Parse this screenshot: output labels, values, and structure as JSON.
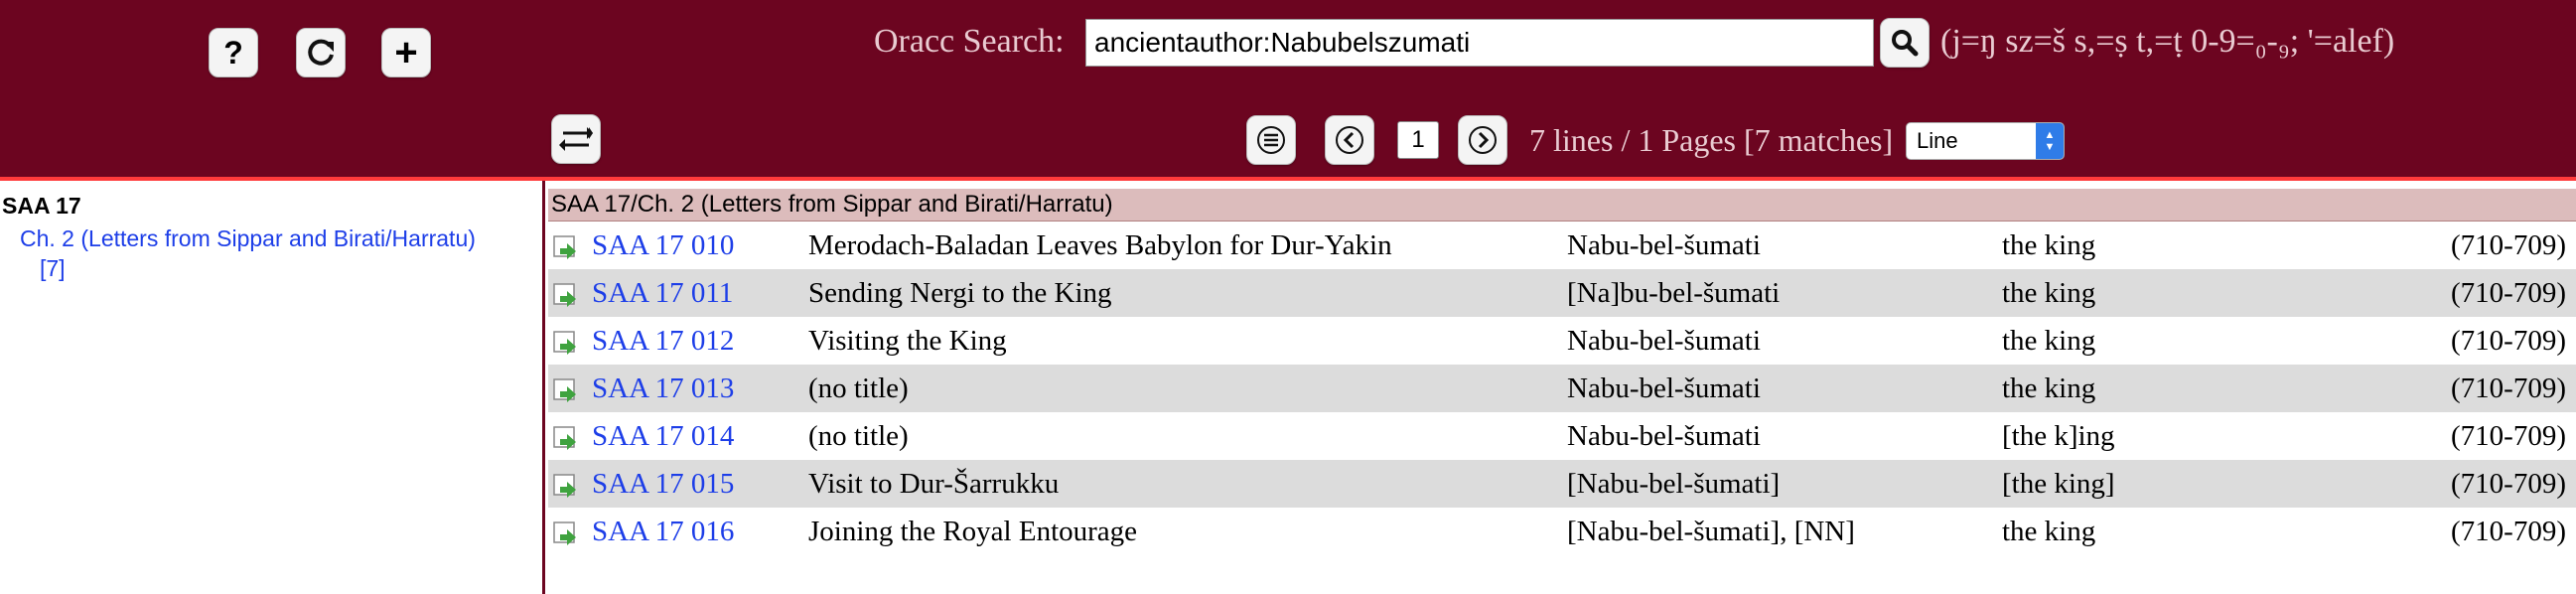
{
  "toolbar": {
    "buttons": [
      {
        "name": "help",
        "icon": "question-icon",
        "label": "?"
      },
      {
        "name": "reset",
        "icon": "refresh-icon"
      },
      {
        "name": "add",
        "icon": "plus-icon",
        "label": "+"
      }
    ]
  },
  "search": {
    "label": "Oracc Search:",
    "value": "ancientauthor:Nabubelszumati",
    "button_icon": "search-icon",
    "hint": "(j=ŋ sz=š s,=ṣ t,=ṭ 0-9=₀-₉; '=alef)"
  },
  "pager": {
    "swap_icon": "swap-arrows-icon",
    "menu_icon": "menu-lines-icon",
    "prev_icon": "chevron-left-icon",
    "next_icon": "chevron-right-icon",
    "page": "1",
    "summary": "7 lines / 1 Pages [7 matches]",
    "view_mode": "Line"
  },
  "sidebar": {
    "title": "SAA 17",
    "chapter": "Ch. 2 (Letters from Sippar and Birati/Harratu)",
    "count": "[7]"
  },
  "results": {
    "header": "SAA 17/Ch. 2 (Letters from Sippar and Birati/Harratu)",
    "rows": [
      {
        "id": "SAA 17 010",
        "title": "Merodach-Baladan Leaves Babylon for Dur-Yakin",
        "author": "Nabu-bel-šumati",
        "recipient": "the king",
        "date": "(710-709)"
      },
      {
        "id": "SAA 17 011",
        "title": "Sending Nergi to the King",
        "author": "[Na]bu-bel-šumati",
        "recipient": "the king",
        "date": "(710-709)"
      },
      {
        "id": "SAA 17 012",
        "title": "Visiting the King",
        "author": "Nabu-bel-šumati",
        "recipient": "the king",
        "date": "(710-709)"
      },
      {
        "id": "SAA 17 013",
        "title": "(no title)",
        "author": "Nabu-bel-šumati",
        "recipient": "the king",
        "date": "(710-709)"
      },
      {
        "id": "SAA 17 014",
        "title": "(no title)",
        "author": "Nabu-bel-šumati",
        "recipient": "[the k]ing",
        "date": "(710-709)"
      },
      {
        "id": "SAA 17 015",
        "title": "Visit to Dur-Šarrukku",
        "author": "[Nabu-bel-šumati]",
        "recipient": "[the king]",
        "date": "(710-709)"
      },
      {
        "id": "SAA 17 016",
        "title": "Joining the Royal Entourage",
        "author": "[Nabu-bel-šumati], [NN]",
        "recipient": "the king",
        "date": "(710-709)"
      }
    ]
  },
  "colors": {
    "header_bg": "#6c0520",
    "accent_line": "#ff3b3b",
    "link": "#1d3ee8",
    "row_alt": "#dcdcdc",
    "group_header": "#dcbcbc"
  }
}
